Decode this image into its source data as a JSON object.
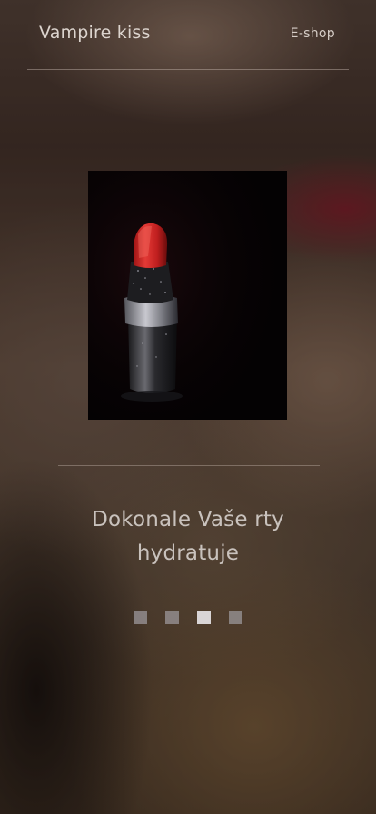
{
  "header": {
    "logo": "Vampire kiss",
    "nav_eshop": "E-shop"
  },
  "slide": {
    "image": "lipstick-product-photo",
    "headline_line1": "Dokonale Vaše rty",
    "headline_line2": "hydratuje"
  },
  "pager": {
    "count": 4,
    "active_index": 2
  },
  "colors": {
    "text": "#dcd4ce",
    "divider": "#c8b9af",
    "pager_inactive": "#96919a",
    "pager_active": "#d9d5d6",
    "lipstick_red": "#d42a2a"
  }
}
